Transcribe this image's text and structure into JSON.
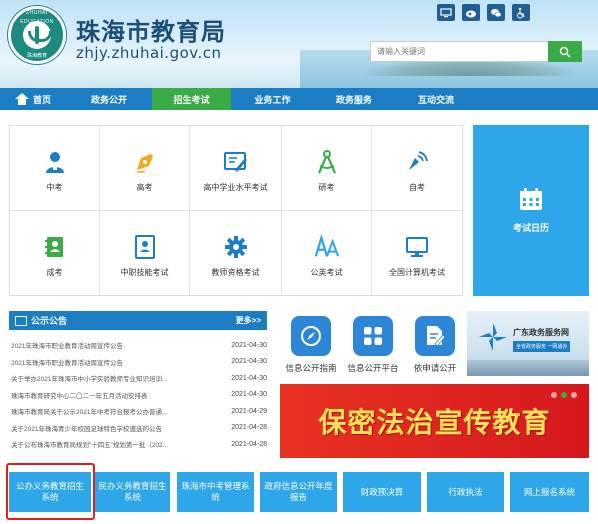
{
  "header": {
    "title": "珠海市教育局",
    "url": "zhjy.zhuhai.gov.cn",
    "logo": {
      "ring_text": "ZHUHAI EDUCATION",
      "bottom_text": "珠海教育"
    },
    "top_icons": [
      "computer-icon",
      "weibo-icon",
      "wechat-icon",
      "accessibility-icon"
    ],
    "search": {
      "placeholder": "请输入关键词",
      "button_icon": "search-icon"
    }
  },
  "nav": {
    "items": [
      {
        "label": "首页",
        "icon": "home-icon"
      },
      {
        "label": "政务公开"
      },
      {
        "label": "招生考试",
        "active": true
      },
      {
        "label": "业务工作"
      },
      {
        "label": "政务服务"
      },
      {
        "label": "互动交流"
      }
    ]
  },
  "exams": [
    {
      "label": "中考",
      "icon": "student-icon"
    },
    {
      "label": "高考",
      "icon": "pen-nib-icon"
    },
    {
      "label": "高中学业水平考试",
      "icon": "certificate-icon"
    },
    {
      "label": "研考",
      "icon": "compass-icon"
    },
    {
      "label": "自考",
      "icon": "broadcast-icon"
    },
    {
      "label": "成考",
      "icon": "address-book-icon"
    },
    {
      "label": "中职技能考试",
      "icon": "id-card-icon"
    },
    {
      "label": "教师资格考试",
      "icon": "gear-icon"
    },
    {
      "label": "公英考试",
      "icon": "font-aa-icon"
    },
    {
      "label": "全国计算机考试",
      "icon": "monitor-icon"
    }
  ],
  "calendar": {
    "label": "考试日历",
    "icon": "calendar-icon"
  },
  "announcements": {
    "title": "公示公告",
    "more": "更多>>",
    "items": [
      {
        "title": "2021年珠海市职业教育活动周宣传公告",
        "date": "2021-04-30"
      },
      {
        "title": "2021年珠海市职业教育活动周宣传公告",
        "date": "2021-04-30"
      },
      {
        "title": "关于举办2021年珠海市中小学实验教师专业知识培训...",
        "date": "2021-04-30"
      },
      {
        "title": "珠海市教育研究中心二〇二一年五月活动安排表",
        "date": "2021-04-30"
      },
      {
        "title": "珠海市教育局关于公示2021年中考符合报考公办普通...",
        "date": "2021-04-29"
      },
      {
        "title": "关于2021年珠海青少年校园足球特色学校遴选的公告",
        "date": "2021-04-28"
      },
      {
        "title": "关于公布珠海市教育局规划“十四五”规划第一批（202...",
        "date": "2021-04-28"
      }
    ]
  },
  "quick_links": [
    {
      "label": "信息公开指南",
      "icon": "compass-icon"
    },
    {
      "label": "信息公开平台",
      "icon": "grid-icon"
    },
    {
      "label": "依申请公开",
      "icon": "document-edit-icon"
    }
  ],
  "gov_service": {
    "title": "广东政务服务网",
    "subtitle": "全省政务服务 一网通办"
  },
  "banner": {
    "text": "保密法治宣传教育"
  },
  "bottom_buttons": [
    {
      "label": "公办义务教育招生系统",
      "highlighted": true
    },
    {
      "label": "民办义务教育招生系统"
    },
    {
      "label": "珠海市中考管理系统"
    },
    {
      "label": "政府信息公开年度报告"
    },
    {
      "label": "财政预决算"
    },
    {
      "label": "行政执法"
    },
    {
      "label": "网上报名系统"
    }
  ],
  "colors": {
    "primary_blue": "#1b7ec4",
    "light_blue": "#2ea7ea",
    "green": "#3aab47",
    "banner_red": "#d5181d",
    "highlight_red": "#e01f1f"
  }
}
